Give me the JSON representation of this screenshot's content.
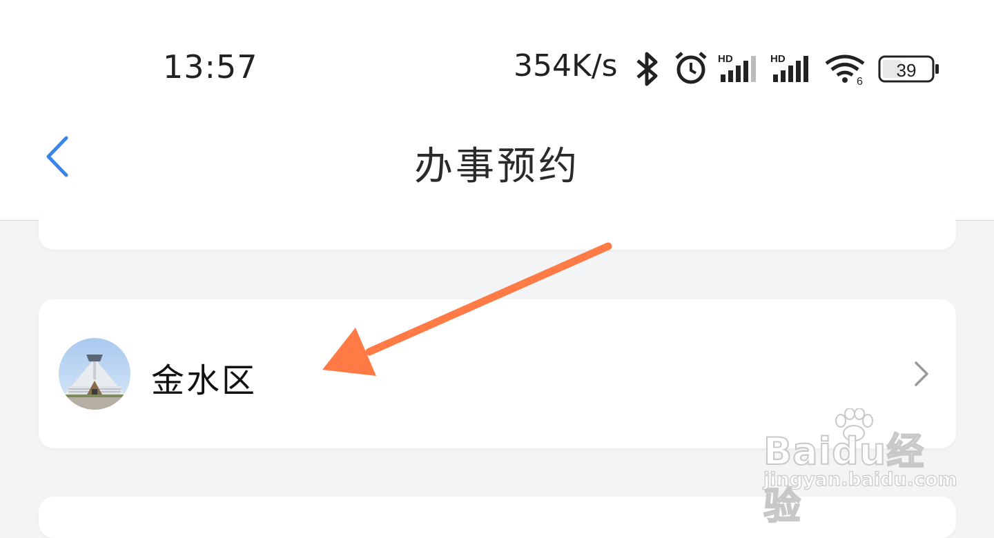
{
  "status_bar": {
    "time": "13:57",
    "network_speed": "354K/s",
    "battery_level": "39",
    "wifi_label": "6",
    "signal_labels": [
      "HD",
      "HD"
    ]
  },
  "header": {
    "title": "办事预约",
    "back_icon": "chevron-left-icon",
    "accent_color": "#3a86e8"
  },
  "list": {
    "items": [
      {
        "label": "金水区",
        "avatar": "museum-building-photo",
        "chevron": "chevron-right-icon"
      }
    ]
  },
  "annotation": {
    "arrow_color": "#ff7a45"
  },
  "watermark": {
    "brand": "Baidu经验",
    "url": "jingyan.baidu.com"
  }
}
